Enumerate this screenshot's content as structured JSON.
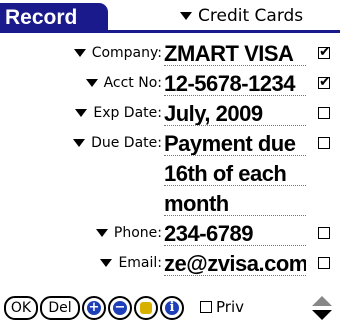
{
  "header": {
    "title": "Record",
    "category": "Credit Cards"
  },
  "fields": [
    {
      "label": "Company:",
      "value": "ZMART VISA",
      "checked": true
    },
    {
      "label": "Acct No:",
      "value": "12-5678-1234",
      "checked": true
    },
    {
      "label": "Exp Date:",
      "value": "July, 2009",
      "checked": false
    },
    {
      "label": "Due Date:",
      "value_lines": [
        "Payment due",
        "16th of each",
        "month"
      ],
      "checked": false
    },
    {
      "label": "Phone:",
      "value": "234-6789",
      "checked": false
    },
    {
      "label": "Email:",
      "value": "ze@zvisa.com",
      "checked": false
    }
  ],
  "toolbar": {
    "ok_label": "OK",
    "del_label": "Del",
    "add_icon": "plus-circle-icon",
    "remove_icon": "minus-circle-icon",
    "note_icon": "note-icon",
    "info_icon": "info-icon",
    "private_label": "Priv",
    "private_checked": false
  },
  "colors": {
    "title_bg": "#1a1a8c",
    "add_icon": "#1d3fb8",
    "remove_icon": "#1d3fb8",
    "note_icon": "#d8b000",
    "info_icon": "#1d3fb8"
  }
}
